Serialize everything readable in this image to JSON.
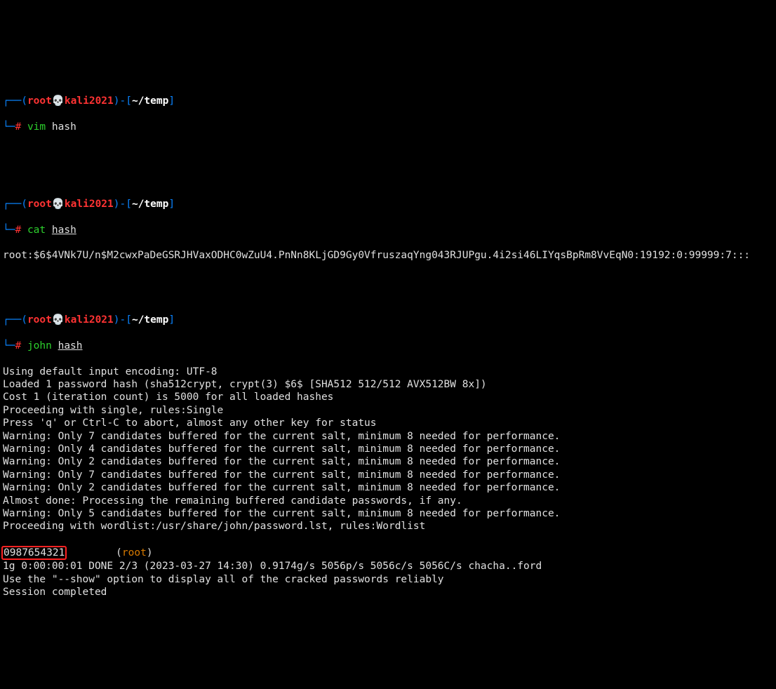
{
  "prompts": [
    {
      "user": "root",
      "host": "kali2021",
      "cwd": "~/temp",
      "cmd": "vim",
      "arg": "hash",
      "ul": false
    },
    {
      "user": "root",
      "host": "kali2021",
      "cwd": "~/temp",
      "cmd": "cat",
      "arg": "hash",
      "ul": true
    },
    {
      "user": "root",
      "host": "kali2021",
      "cwd": "~/temp",
      "cmd": "john",
      "arg": "hash",
      "ul": true
    }
  ],
  "cat_output": "root:$6$4VNk7U/n$M2cwxPaDeGSRJHVaxODHC0wZuU4.PnNn8KLjGD9Gy0VfruszaqYng043RJUPgu.4i2si46LIYqsBpRm8VvEqN0:19192:0:99999:7:::",
  "john": {
    "lines1": [
      "Using default input encoding: UTF-8",
      "Loaded 1 password hash (sha512crypt, crypt(3) $6$ [SHA512 512/512 AVX512BW 8x])",
      "Cost 1 (iteration count) is 5000 for all loaded hashes",
      "Proceeding with single, rules:Single",
      "Press 'q' or Ctrl-C to abort, almost any other key for status",
      "Warning: Only 7 candidates buffered for the current salt, minimum 8 needed for performance.",
      "Warning: Only 4 candidates buffered for the current salt, minimum 8 needed for performance.",
      "Warning: Only 2 candidates buffered for the current salt, minimum 8 needed for performance.",
      "Warning: Only 7 candidates buffered for the current salt, minimum 8 needed for performance.",
      "Warning: Only 2 candidates buffered for the current salt, minimum 8 needed for performance.",
      "Almost done: Processing the remaining buffered candidate passwords, if any.",
      "Warning: Only 5 candidates buffered for the current salt, minimum 8 needed for performance.",
      "Proceeding with wordlist:/usr/share/john/password.lst, rules:Wordlist"
    ],
    "cracked_pw": "0987654321",
    "cracked_gap": "        ",
    "cracked_user": "root",
    "lines2": [
      "1g 0:00:00:01 DONE 2/3 (2023-03-27 14:30) 0.9174g/s 5056p/s 5056c/s 5056C/s chacha..ford",
      "Use the \"--show\" option to display all of the cracked passwords reliably",
      "Session completed"
    ]
  },
  "glyph": {
    "skull": "💀",
    "top": "┌──",
    "bot": "└─"
  }
}
